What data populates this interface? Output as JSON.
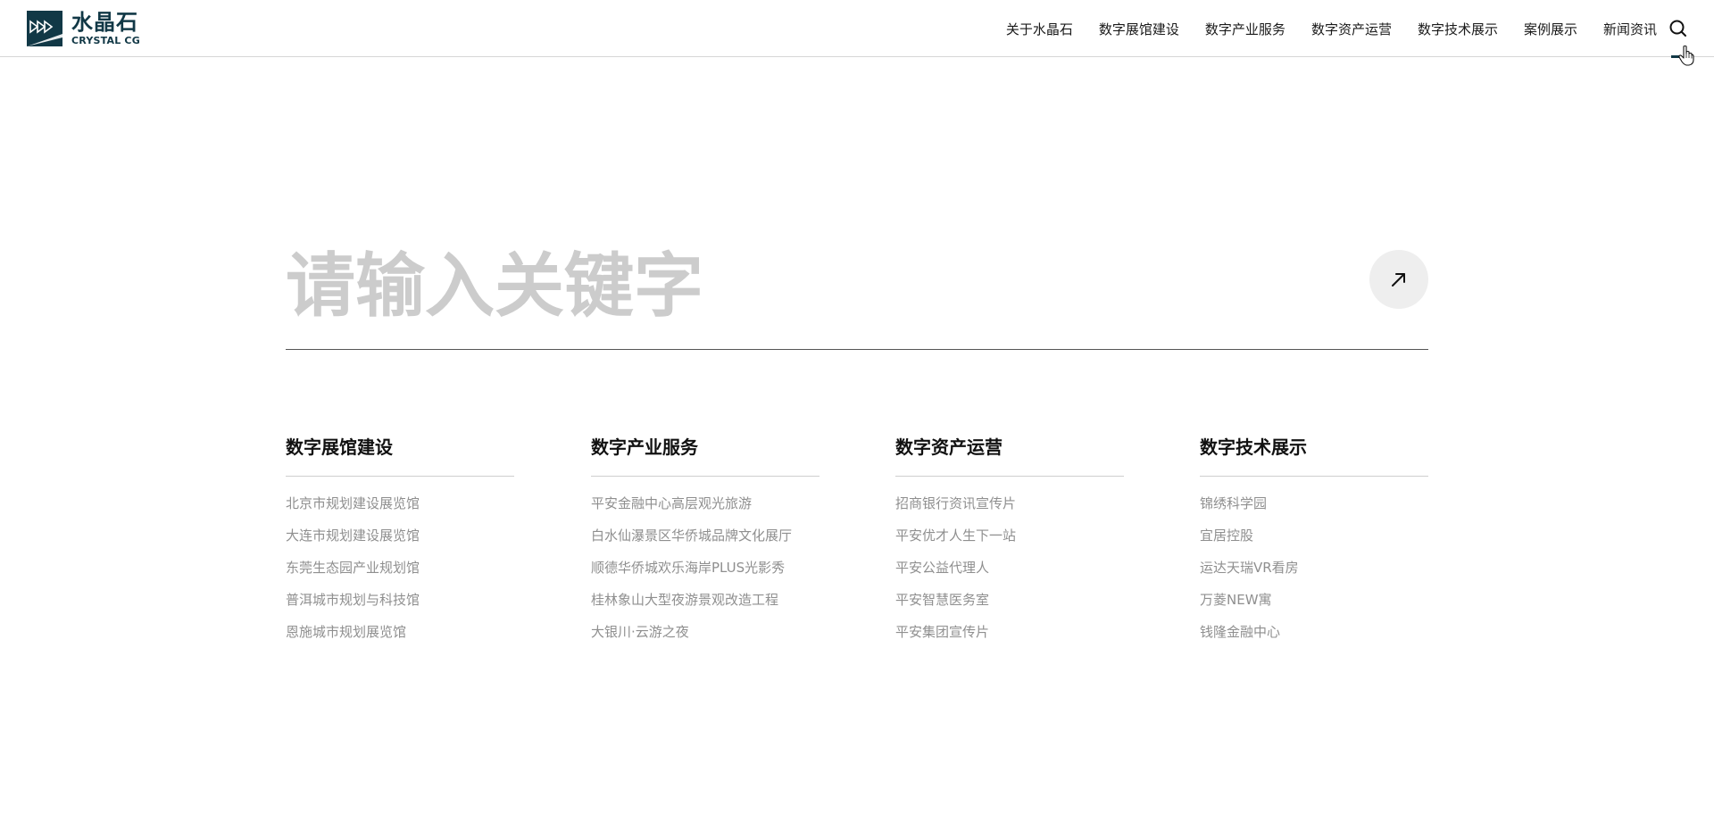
{
  "brand": {
    "name_cn": "水晶石",
    "name_en": "CRYSTAL CG",
    "color": "#113846"
  },
  "nav": {
    "items": [
      {
        "label": "关于水晶石"
      },
      {
        "label": "数字展馆建设"
      },
      {
        "label": "数字产业服务"
      },
      {
        "label": "数字资产运营"
      },
      {
        "label": "数字技术展示"
      },
      {
        "label": "案例展示"
      },
      {
        "label": "新闻资讯"
      }
    ],
    "search_icon": "search-icon"
  },
  "search": {
    "placeholder": "请输入关键字",
    "value": "",
    "submit_icon": "arrow-up-right-icon"
  },
  "categories": [
    {
      "title": "数字展馆建设",
      "items": [
        "北京市规划建设展览馆",
        "大连市规划建设展览馆",
        "东莞生态园产业规划馆",
        "普洱城市规划与科技馆",
        "恩施城市规划展览馆"
      ]
    },
    {
      "title": "数字产业服务",
      "items": [
        "平安金融中心高层观光旅游",
        "白水仙瀑景区华侨城品牌文化展厅",
        "顺德华侨城欢乐海岸PLUS光影秀",
        "桂林象山大型夜游景观改造工程",
        "大银川·云游之夜"
      ]
    },
    {
      "title": "数字资产运营",
      "items": [
        "招商银行资讯宣传片",
        "平安优才人生下一站",
        "平安公益代理人",
        "平安智慧医务室",
        "平安集团宣传片"
      ]
    },
    {
      "title": "数字技术展示",
      "items": [
        "锦绣科学园",
        "宜居控股",
        "运达天瑞VR看房",
        "万菱NEW寓",
        "钱隆金融中心"
      ]
    }
  ]
}
